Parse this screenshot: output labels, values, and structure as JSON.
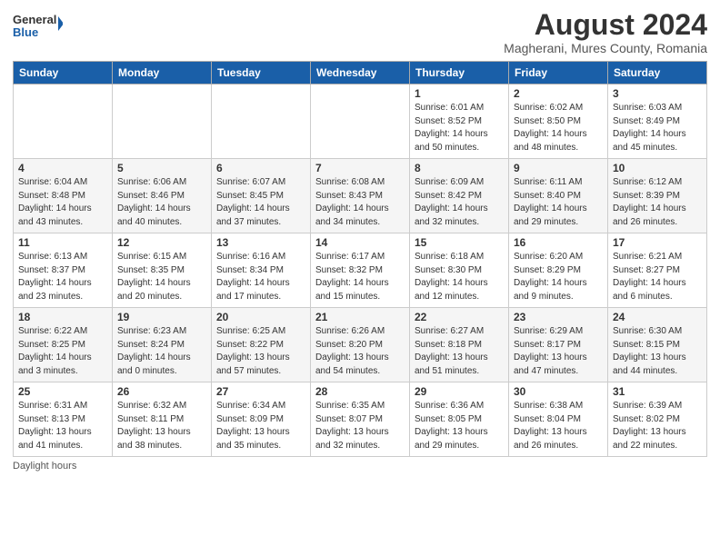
{
  "logo": {
    "general": "General",
    "blue": "Blue"
  },
  "title": "August 2024",
  "subtitle": "Magherani, Mures County, Romania",
  "days_header": [
    "Sunday",
    "Monday",
    "Tuesday",
    "Wednesday",
    "Thursday",
    "Friday",
    "Saturday"
  ],
  "weeks": [
    [
      {
        "num": "",
        "info": ""
      },
      {
        "num": "",
        "info": ""
      },
      {
        "num": "",
        "info": ""
      },
      {
        "num": "",
        "info": ""
      },
      {
        "num": "1",
        "info": "Sunrise: 6:01 AM\nSunset: 8:52 PM\nDaylight: 14 hours\nand 50 minutes."
      },
      {
        "num": "2",
        "info": "Sunrise: 6:02 AM\nSunset: 8:50 PM\nDaylight: 14 hours\nand 48 minutes."
      },
      {
        "num": "3",
        "info": "Sunrise: 6:03 AM\nSunset: 8:49 PM\nDaylight: 14 hours\nand 45 minutes."
      }
    ],
    [
      {
        "num": "4",
        "info": "Sunrise: 6:04 AM\nSunset: 8:48 PM\nDaylight: 14 hours\nand 43 minutes."
      },
      {
        "num": "5",
        "info": "Sunrise: 6:06 AM\nSunset: 8:46 PM\nDaylight: 14 hours\nand 40 minutes."
      },
      {
        "num": "6",
        "info": "Sunrise: 6:07 AM\nSunset: 8:45 PM\nDaylight: 14 hours\nand 37 minutes."
      },
      {
        "num": "7",
        "info": "Sunrise: 6:08 AM\nSunset: 8:43 PM\nDaylight: 14 hours\nand 34 minutes."
      },
      {
        "num": "8",
        "info": "Sunrise: 6:09 AM\nSunset: 8:42 PM\nDaylight: 14 hours\nand 32 minutes."
      },
      {
        "num": "9",
        "info": "Sunrise: 6:11 AM\nSunset: 8:40 PM\nDaylight: 14 hours\nand 29 minutes."
      },
      {
        "num": "10",
        "info": "Sunrise: 6:12 AM\nSunset: 8:39 PM\nDaylight: 14 hours\nand 26 minutes."
      }
    ],
    [
      {
        "num": "11",
        "info": "Sunrise: 6:13 AM\nSunset: 8:37 PM\nDaylight: 14 hours\nand 23 minutes."
      },
      {
        "num": "12",
        "info": "Sunrise: 6:15 AM\nSunset: 8:35 PM\nDaylight: 14 hours\nand 20 minutes."
      },
      {
        "num": "13",
        "info": "Sunrise: 6:16 AM\nSunset: 8:34 PM\nDaylight: 14 hours\nand 17 minutes."
      },
      {
        "num": "14",
        "info": "Sunrise: 6:17 AM\nSunset: 8:32 PM\nDaylight: 14 hours\nand 15 minutes."
      },
      {
        "num": "15",
        "info": "Sunrise: 6:18 AM\nSunset: 8:30 PM\nDaylight: 14 hours\nand 12 minutes."
      },
      {
        "num": "16",
        "info": "Sunrise: 6:20 AM\nSunset: 8:29 PM\nDaylight: 14 hours\nand 9 minutes."
      },
      {
        "num": "17",
        "info": "Sunrise: 6:21 AM\nSunset: 8:27 PM\nDaylight: 14 hours\nand 6 minutes."
      }
    ],
    [
      {
        "num": "18",
        "info": "Sunrise: 6:22 AM\nSunset: 8:25 PM\nDaylight: 14 hours\nand 3 minutes."
      },
      {
        "num": "19",
        "info": "Sunrise: 6:23 AM\nSunset: 8:24 PM\nDaylight: 14 hours\nand 0 minutes."
      },
      {
        "num": "20",
        "info": "Sunrise: 6:25 AM\nSunset: 8:22 PM\nDaylight: 13 hours\nand 57 minutes."
      },
      {
        "num": "21",
        "info": "Sunrise: 6:26 AM\nSunset: 8:20 PM\nDaylight: 13 hours\nand 54 minutes."
      },
      {
        "num": "22",
        "info": "Sunrise: 6:27 AM\nSunset: 8:18 PM\nDaylight: 13 hours\nand 51 minutes."
      },
      {
        "num": "23",
        "info": "Sunrise: 6:29 AM\nSunset: 8:17 PM\nDaylight: 13 hours\nand 47 minutes."
      },
      {
        "num": "24",
        "info": "Sunrise: 6:30 AM\nSunset: 8:15 PM\nDaylight: 13 hours\nand 44 minutes."
      }
    ],
    [
      {
        "num": "25",
        "info": "Sunrise: 6:31 AM\nSunset: 8:13 PM\nDaylight: 13 hours\nand 41 minutes."
      },
      {
        "num": "26",
        "info": "Sunrise: 6:32 AM\nSunset: 8:11 PM\nDaylight: 13 hours\nand 38 minutes."
      },
      {
        "num": "27",
        "info": "Sunrise: 6:34 AM\nSunset: 8:09 PM\nDaylight: 13 hours\nand 35 minutes."
      },
      {
        "num": "28",
        "info": "Sunrise: 6:35 AM\nSunset: 8:07 PM\nDaylight: 13 hours\nand 32 minutes."
      },
      {
        "num": "29",
        "info": "Sunrise: 6:36 AM\nSunset: 8:05 PM\nDaylight: 13 hours\nand 29 minutes."
      },
      {
        "num": "30",
        "info": "Sunrise: 6:38 AM\nSunset: 8:04 PM\nDaylight: 13 hours\nand 26 minutes."
      },
      {
        "num": "31",
        "info": "Sunrise: 6:39 AM\nSunset: 8:02 PM\nDaylight: 13 hours\nand 22 minutes."
      }
    ]
  ],
  "footer": "Daylight hours"
}
